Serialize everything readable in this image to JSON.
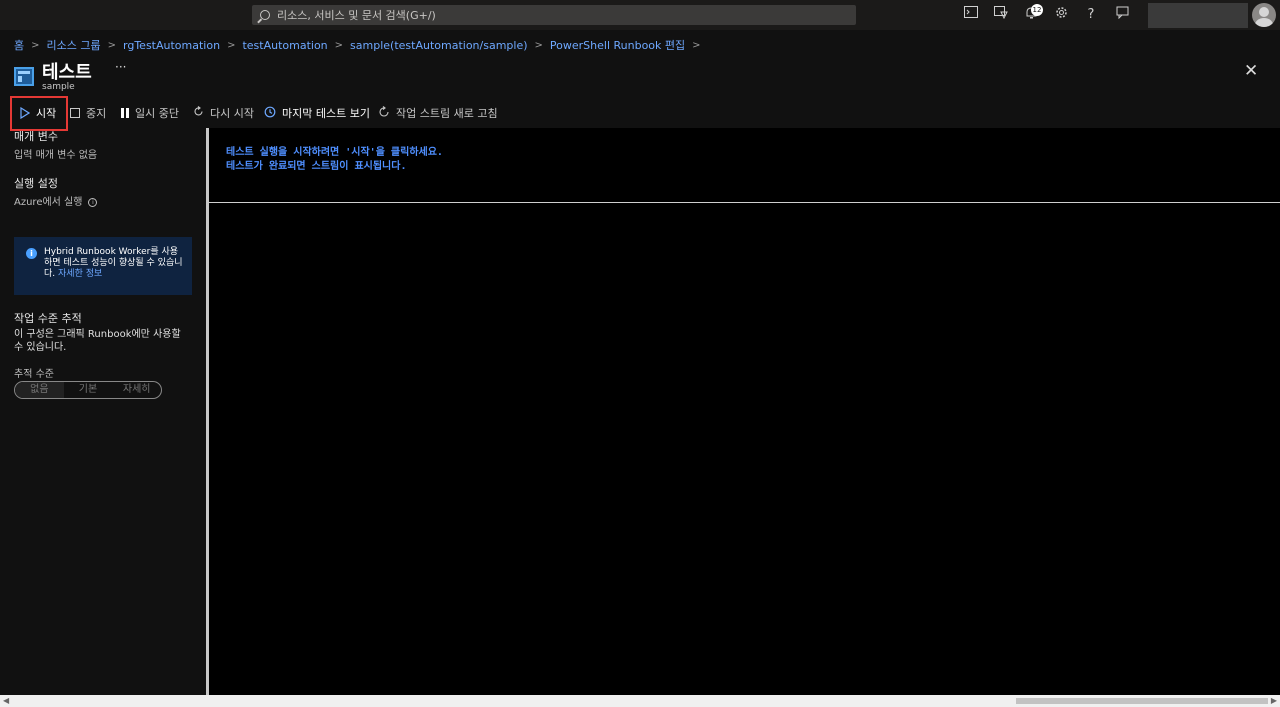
{
  "search": {
    "placeholder": "리소스, 서비스 및 문서 검색(G+/)"
  },
  "topbar": {
    "notification_count": "12"
  },
  "breadcrumb": [
    "홈",
    "리소스 그룹",
    "rgTestAutomation",
    "testAutomation",
    "sample(testAutomation/sample)",
    "PowerShell Runbook 편집"
  ],
  "header": {
    "title": "테스트",
    "subtitle": "sample",
    "more": "···"
  },
  "toolbar": {
    "start": "시작",
    "stop": "중지",
    "pause": "일시 중단",
    "restart": "다시 시작",
    "last_test": "마지막 테스트 보기",
    "refresh": "작업 스트림 새로 고침"
  },
  "left": {
    "params_title": "매개 변수",
    "params_none": "입력 매개 변수 없음",
    "run_settings_title": "실행 설정",
    "run_on": "Azure에서 실행",
    "info_text": "Hybrid Runbook Worker를 사용하면 테스트 성능이 향상될 수 있습니다.",
    "info_link": "자세한 정보",
    "job_trace_title": "작업 수준 추적",
    "job_trace_desc": "이 구성은 그래픽 Runbook에만 사용할 수 있습니다.",
    "trace_level_label": "추적 수준",
    "trace_options": [
      "없음",
      "기본",
      "자세히"
    ]
  },
  "console": {
    "line1": "테스트 실행을 시작하려면 '시작'을 클릭하세요.",
    "line2": "테스트가 완료되면 스트림이 표시됩니다."
  },
  "colors": {
    "accent": "#6ea8ff",
    "highlight": "#e53935",
    "console_text": "#4f8fff"
  }
}
